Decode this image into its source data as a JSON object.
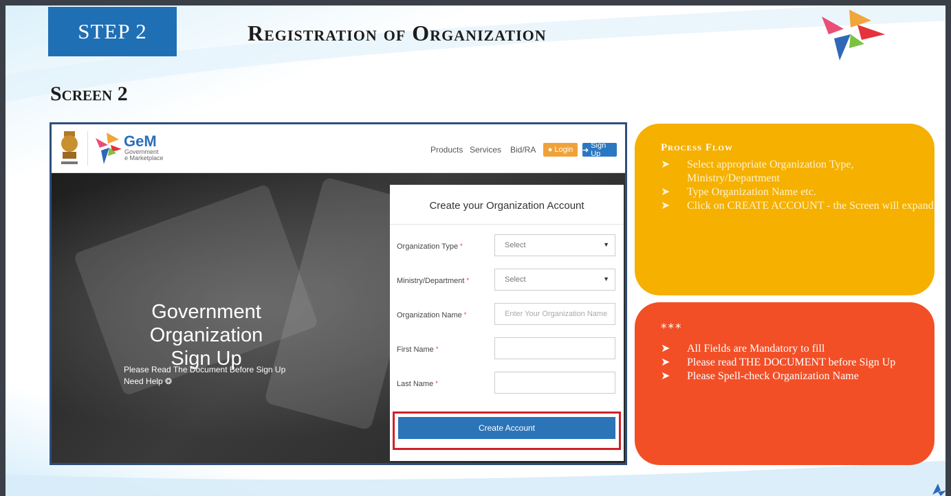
{
  "slide": {
    "step_label": "STEP 2",
    "title": "Registration of Organization",
    "screen_label": "Screen 2",
    "logo_icon": "gem-star-logo"
  },
  "screenshot": {
    "nav": {
      "brand": "GeM",
      "brand_sub_1": "Government",
      "brand_sub_2": "e Marketplace",
      "links": [
        "Products",
        "Services",
        "Bid/RA"
      ],
      "login_label": "Login",
      "signup_label": "Sign Up"
    },
    "hero": {
      "title_line1": "Government Organization",
      "title_line2": "Sign Up",
      "note": "Please Read The Document Before Sign Up",
      "help": "Need Help"
    },
    "form": {
      "title": "Create your Organization Account",
      "fields": [
        {
          "label": "Organization Type",
          "value": "Select",
          "type": "select"
        },
        {
          "label": "Ministry/Department",
          "value": "Select",
          "type": "select"
        },
        {
          "label": "Organization Name",
          "placeholder": "Enter Your Organization Name",
          "type": "text"
        },
        {
          "label": "First Name",
          "value": "",
          "type": "text"
        },
        {
          "label": "Last Name",
          "value": "",
          "type": "text"
        }
      ],
      "required_mark": "*",
      "submit_label": "Create Account"
    }
  },
  "process_flow": {
    "heading": "Process Flow",
    "items": [
      "Select  appropriate Organization Type, Ministry/Department",
      "Type Organization Name  etc.",
      "Click on CREATE ACCOUNT - the Screen will expand"
    ]
  },
  "notes": {
    "heading": "***",
    "items": [
      "All Fields are Mandatory to fill",
      "Please read THE DOCUMENT before Sign Up",
      "Please Spell-check Organization Name"
    ]
  },
  "colors": {
    "step_blue": "#1f6fb5",
    "yellow_panel": "#f5b000",
    "red_panel": "#f24f27",
    "highlight_red": "#d0202a",
    "button_blue": "#2b74b8"
  }
}
